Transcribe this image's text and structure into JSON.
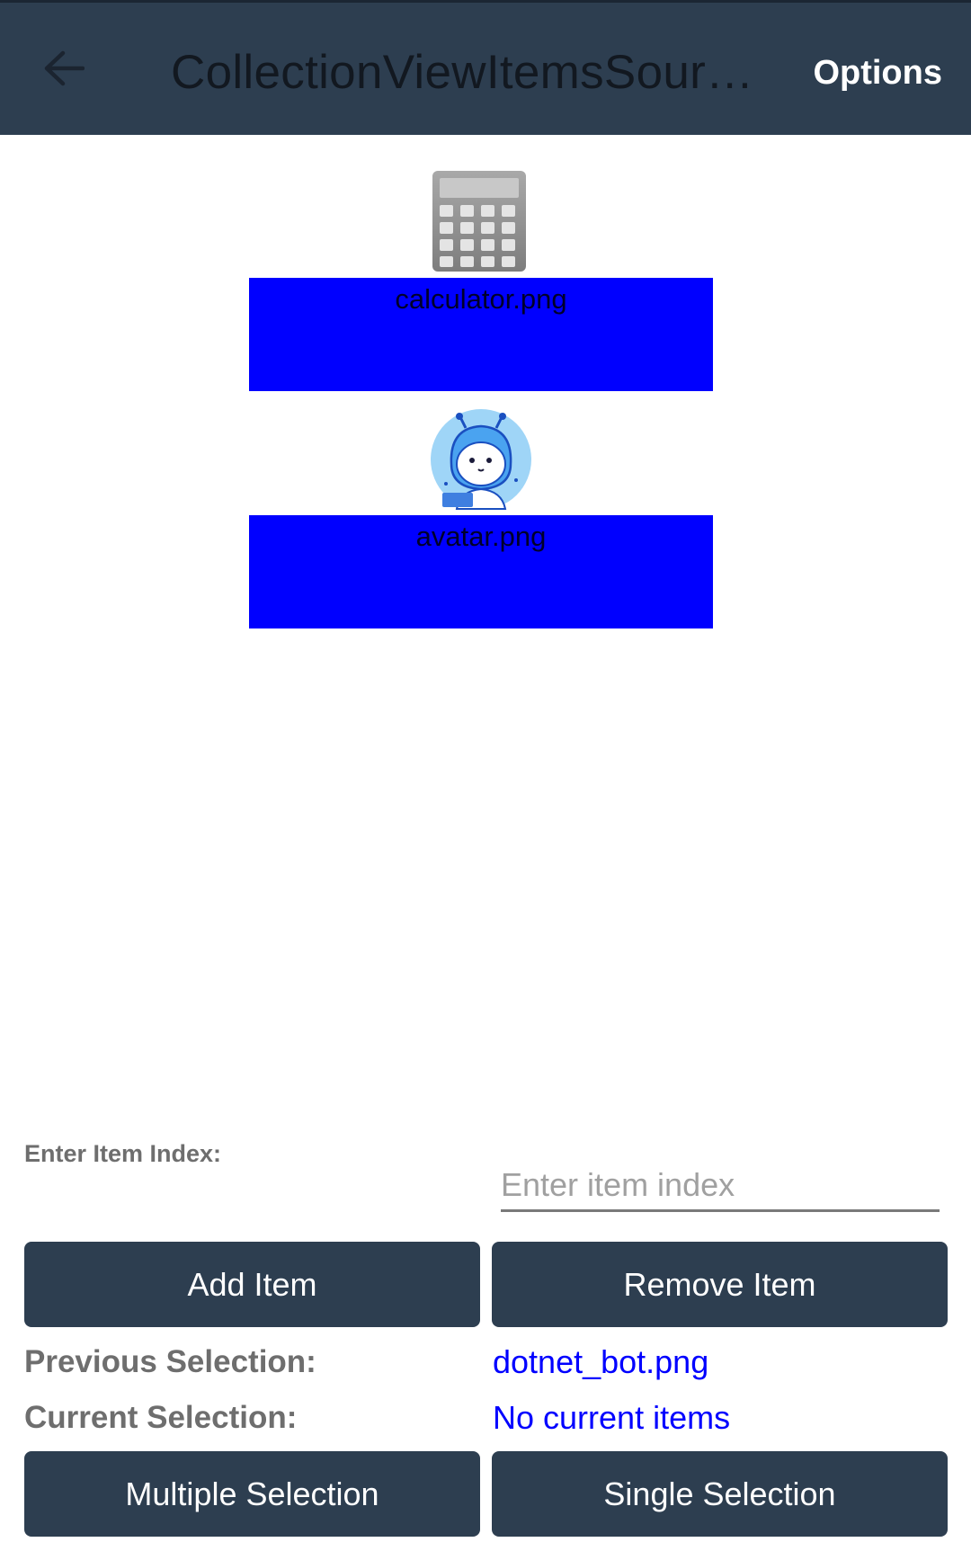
{
  "app_bar": {
    "back_icon": "arrow-left-icon",
    "title": "CollectionViewItemsSour…",
    "options_label": "Options"
  },
  "items": [
    {
      "label": "calculator.png",
      "icon": "calculator-icon"
    },
    {
      "label": "avatar.png",
      "icon": "avatar-icon"
    }
  ],
  "index_section": {
    "label": "Enter Item Index:",
    "placeholder": "Enter item index",
    "value": ""
  },
  "buttons": {
    "add_item": "Add Item",
    "remove_item": "Remove Item",
    "multiple_selection": "Multiple Selection",
    "single_selection": "Single Selection"
  },
  "selection": {
    "previous_label": "Previous Selection:",
    "previous_value": "dotnet_bot.png",
    "current_label": "Current Selection:",
    "current_value": "No current items"
  },
  "colors": {
    "app_bar": "#2d3e50",
    "item_background": "#0000ff",
    "selection_value": "#0000ff",
    "button": "#2d3e50"
  }
}
